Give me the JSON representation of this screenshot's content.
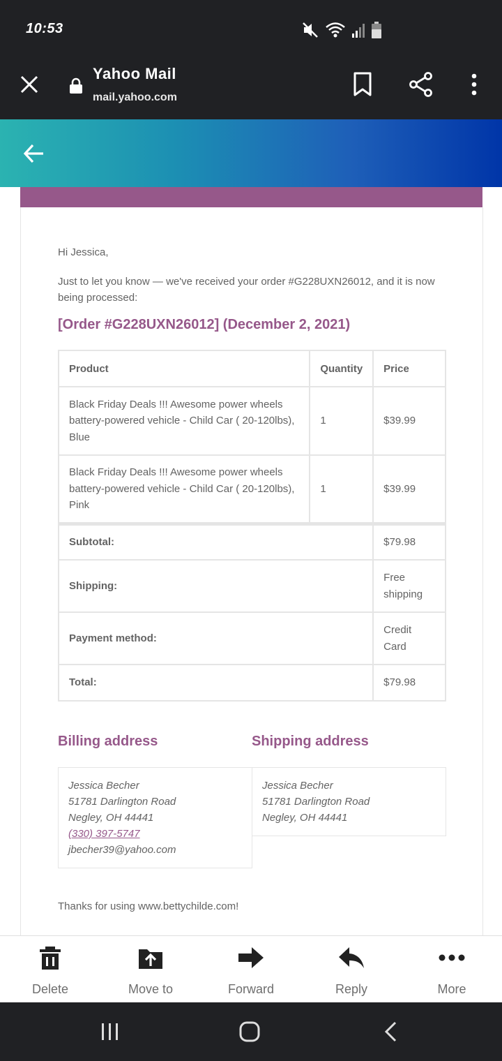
{
  "status_bar": {
    "time": "10:53"
  },
  "browser": {
    "title": "Yahoo Mail",
    "url": "mail.yahoo.com"
  },
  "email": {
    "greeting": "Hi Jessica,",
    "intro": "Just to let you know — we've received your order #G228UXN26012, and it is now being processed:",
    "order_heading": "[Order #G228UXN26012] (December 2, 2021)",
    "table": {
      "headers": {
        "product": "Product",
        "quantity": "Quantity",
        "price": "Price"
      },
      "items": [
        {
          "product": "Black Friday Deals !!! Awesome power wheels battery-powered vehicle - Child Car ( 20-120lbs), Blue",
          "quantity": "1",
          "price": "$39.99"
        },
        {
          "product": "Black Friday Deals !!! Awesome power wheels battery-powered vehicle - Child Car ( 20-120lbs), Pink",
          "quantity": "1",
          "price": "$39.99"
        }
      ],
      "totals": [
        {
          "label": "Subtotal:",
          "value": "$79.98"
        },
        {
          "label": "Shipping:",
          "value": "Free shipping"
        },
        {
          "label": "Payment method:",
          "value": "Credit Card"
        },
        {
          "label": "Total:",
          "value": "$79.98"
        }
      ]
    },
    "billing": {
      "title": "Billing address",
      "name": "Jessica Becher",
      "street": "51781 Darlington Road",
      "city": "Negley, OH 44441",
      "phone": "(330) 397-5747",
      "email": "jbecher39@yahoo.com"
    },
    "shipping": {
      "title": "Shipping address",
      "name": "Jessica Becher",
      "street": "51781 Darlington Road",
      "city": "Negley, OH 44441"
    },
    "thanks": "Thanks for using www.bettychilde.com!"
  },
  "actions": {
    "delete": "Delete",
    "move_to": "Move to",
    "forward": "Forward",
    "reply": "Reply",
    "more": "More"
  },
  "colors": {
    "accent": "#96588a",
    "text": "#636363",
    "chrome": "#202124"
  }
}
